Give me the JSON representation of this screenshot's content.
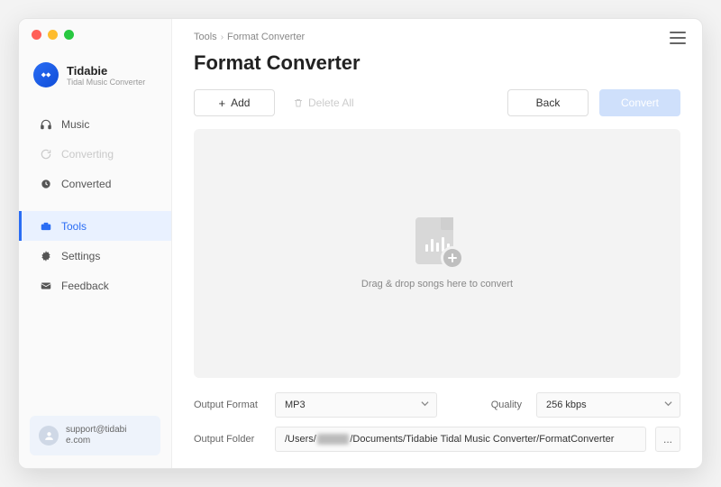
{
  "brand": {
    "name": "Tidabie",
    "subtitle": "Tidal Music Converter"
  },
  "sidebar": {
    "items": [
      {
        "label": "Music"
      },
      {
        "label": "Converting"
      },
      {
        "label": "Converted"
      },
      {
        "label": "Tools"
      },
      {
        "label": "Settings"
      },
      {
        "label": "Feedback"
      }
    ],
    "active_index": 3
  },
  "support": {
    "line1": "support@tidabi",
    "line2": "e.com"
  },
  "breadcrumb": {
    "root": "Tools",
    "current": "Format Converter"
  },
  "page": {
    "title": "Format Converter"
  },
  "toolbar": {
    "add_label": "Add",
    "delete_all_label": "Delete All",
    "back_label": "Back",
    "convert_label": "Convert"
  },
  "dropzone": {
    "hint": "Drag & drop songs here to convert"
  },
  "form": {
    "output_format_label": "Output Format",
    "output_format_value": "MP3",
    "quality_label": "Quality",
    "quality_value": "256 kbps",
    "output_folder_label": "Output Folder",
    "output_folder_prefix": "/Users/",
    "output_folder_hidden": "xxxxx",
    "output_folder_suffix": "/Documents/Tidabie Tidal Music Converter/FormatConverter",
    "browse_label": "..."
  }
}
